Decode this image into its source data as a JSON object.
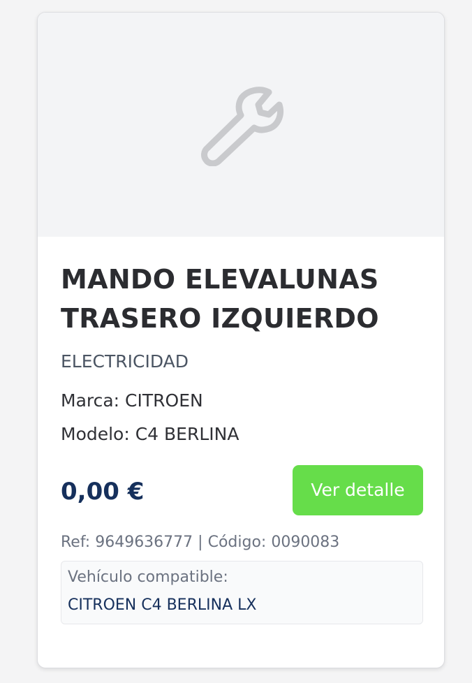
{
  "product": {
    "image_placeholder_icon": "wrench-icon",
    "title": "MANDO ELEVALUNAS TRASERO IZQUIERDO",
    "category": "ELECTRICIDAD",
    "marca": "Marca: CITROEN",
    "modelo": "Modelo: C4 BERLINA",
    "price": "0,00 €",
    "ref": "Ref: 9649636777",
    "separator": "|",
    "codigo": "Código: 0090083",
    "compat_label": "Vehículo compatible:",
    "compat_value": "CITROEN C4 BERLINA LX"
  },
  "actions": {
    "detail_button": "Ver detalle"
  },
  "colors": {
    "accent_button": "#66dd4a",
    "price_text": "#16305c",
    "title_text": "#2b2c30",
    "image_bg": "#f3f4f6",
    "icon": "#c9cacd"
  }
}
